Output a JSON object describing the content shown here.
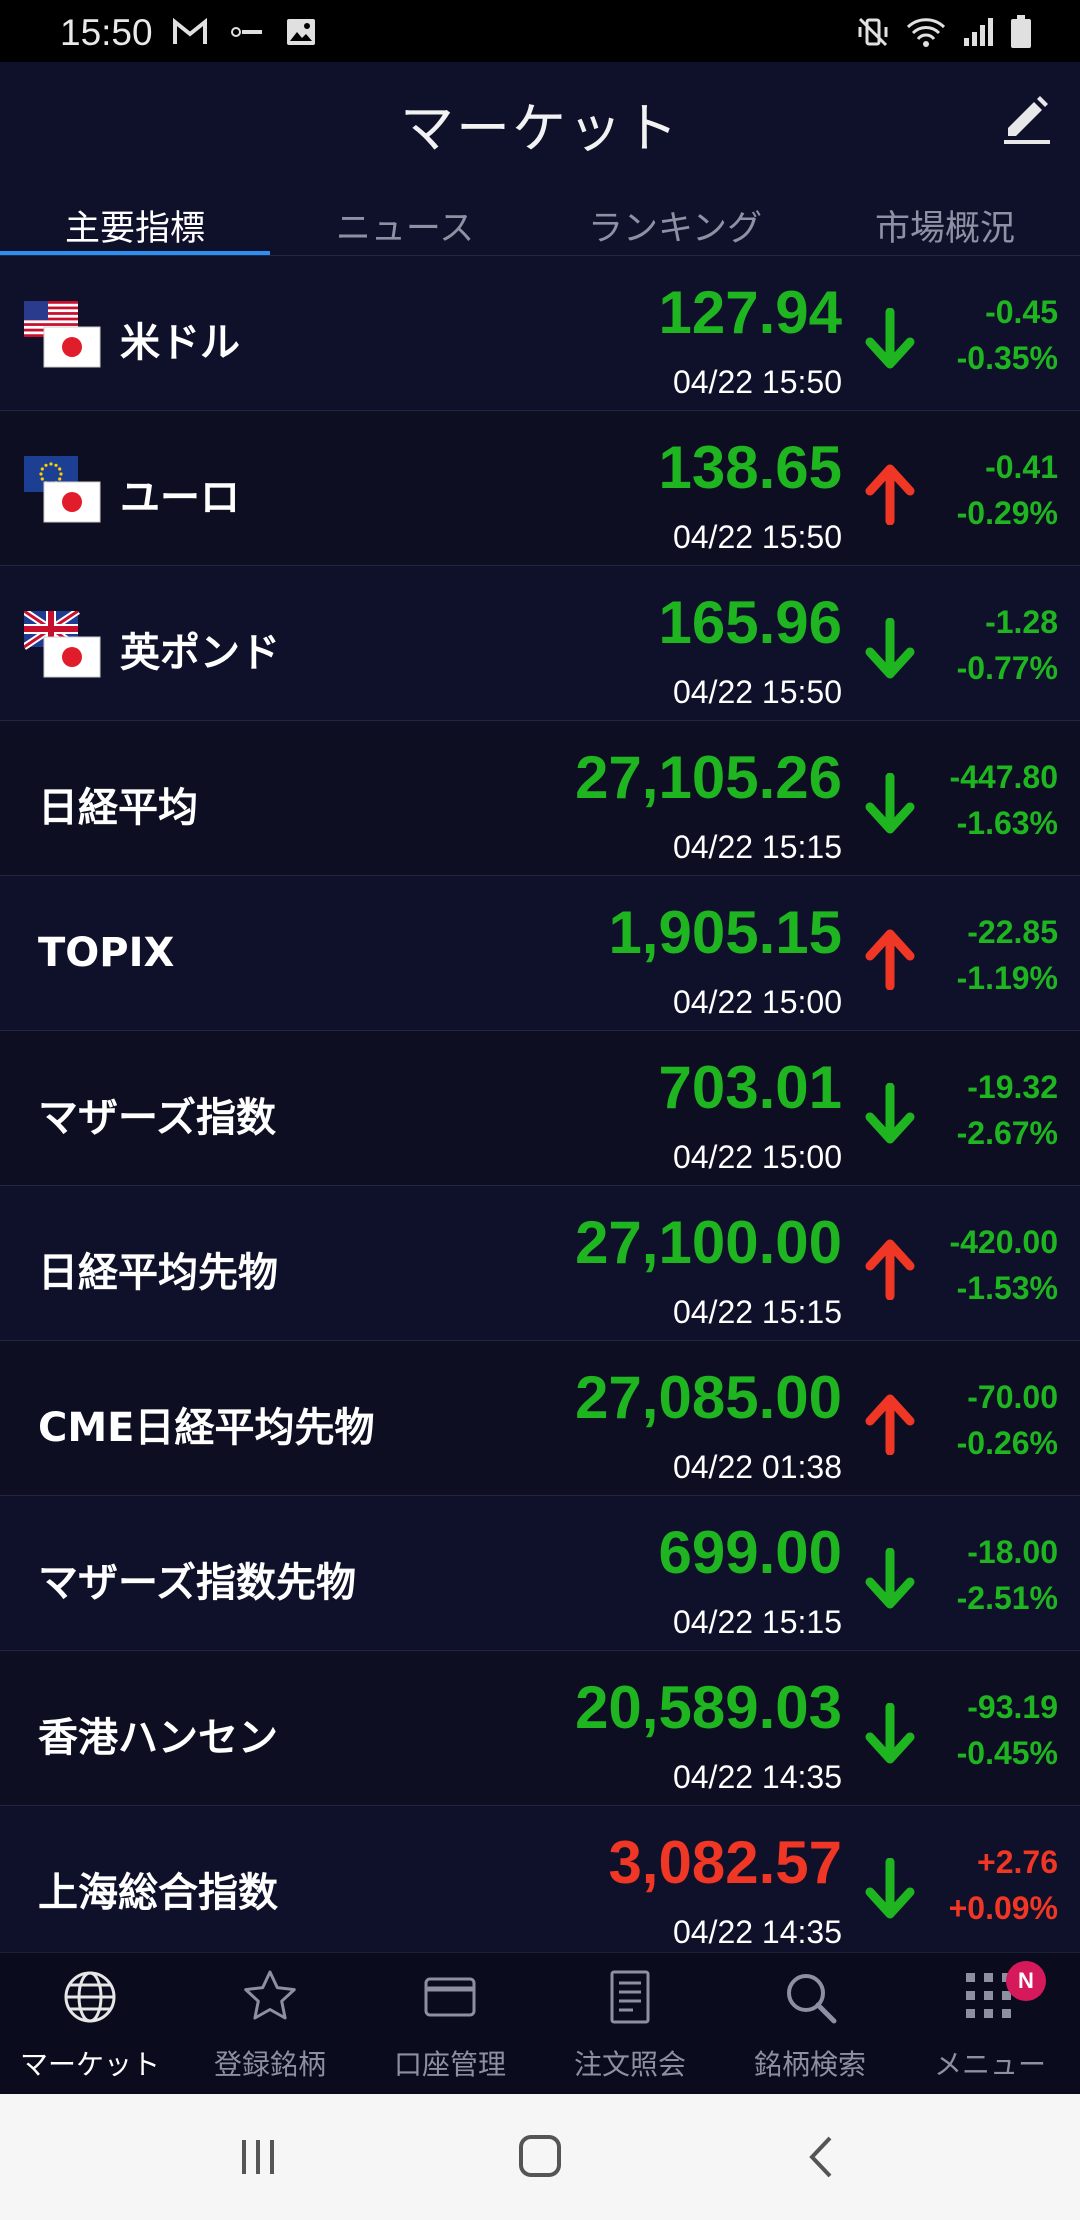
{
  "status_bar": {
    "time": "15:50"
  },
  "header": {
    "title": "マーケット"
  },
  "tabs": [
    {
      "label": "主要指標",
      "active": true
    },
    {
      "label": "ニュース",
      "active": false
    },
    {
      "label": "ランキング",
      "active": false
    },
    {
      "label": "市場概況",
      "active": false
    }
  ],
  "market_rows": [
    {
      "name": "米ドル",
      "flag": "us-jp",
      "price": "127.94",
      "time": "04/22 15:50",
      "arrow": "down",
      "change": "-0.45",
      "pct": "-0.35%",
      "price_color": "up",
      "change_color": "up"
    },
    {
      "name": "ユーロ",
      "flag": "eu-jp",
      "price": "138.65",
      "time": "04/22 15:50",
      "arrow": "up",
      "change": "-0.41",
      "pct": "-0.29%",
      "price_color": "up",
      "change_color": "up"
    },
    {
      "name": "英ポンド",
      "flag": "uk-jp",
      "price": "165.96",
      "time": "04/22 15:50",
      "arrow": "down",
      "change": "-1.28",
      "pct": "-0.77%",
      "price_color": "up",
      "change_color": "up"
    },
    {
      "name": "日経平均",
      "flag": "",
      "price": "27,105.26",
      "time": "04/22 15:15",
      "arrow": "down",
      "change": "-447.80",
      "pct": "-1.63%",
      "price_color": "up",
      "change_color": "up"
    },
    {
      "name": "TOPIX",
      "flag": "",
      "price": "1,905.15",
      "time": "04/22 15:00",
      "arrow": "up",
      "change": "-22.85",
      "pct": "-1.19%",
      "price_color": "up",
      "change_color": "up"
    },
    {
      "name": "マザーズ指数",
      "flag": "",
      "price": "703.01",
      "time": "04/22 15:00",
      "arrow": "down",
      "change": "-19.32",
      "pct": "-2.67%",
      "price_color": "up",
      "change_color": "up"
    },
    {
      "name": "日経平均先物",
      "flag": "",
      "price": "27,100.00",
      "time": "04/22 15:15",
      "arrow": "up",
      "change": "-420.00",
      "pct": "-1.53%",
      "price_color": "up",
      "change_color": "up"
    },
    {
      "name": "CME日経平均先物",
      "flag": "",
      "price": "27,085.00",
      "time": "04/22 01:38",
      "arrow": "up",
      "change": "-70.00",
      "pct": "-0.26%",
      "price_color": "up",
      "change_color": "up"
    },
    {
      "name": "マザーズ指数先物",
      "flag": "",
      "price": "699.00",
      "time": "04/22 15:15",
      "arrow": "down",
      "change": "-18.00",
      "pct": "-2.51%",
      "price_color": "up",
      "change_color": "up"
    },
    {
      "name": "香港ハンセン",
      "flag": "",
      "price": "20,589.03",
      "time": "04/22 14:35",
      "arrow": "down",
      "change": "-93.19",
      "pct": "-0.45%",
      "price_color": "up",
      "change_color": "up"
    },
    {
      "name": "上海総合指数",
      "flag": "",
      "price": "3,082.57",
      "time": "04/22 14:35",
      "arrow": "down",
      "change": "+2.76",
      "pct": "+0.09%",
      "price_color": "down",
      "change_color": "down"
    }
  ],
  "bottom_nav": [
    {
      "label": "マーケット",
      "icon": "globe-icon",
      "active": true
    },
    {
      "label": "登録銘柄",
      "icon": "star-icon",
      "active": false
    },
    {
      "label": "口座管理",
      "icon": "card-icon",
      "active": false
    },
    {
      "label": "注文照会",
      "icon": "document-icon",
      "active": false
    },
    {
      "label": "銘柄検索",
      "icon": "search-icon",
      "active": false
    },
    {
      "label": "メニュー",
      "icon": "grid-icon",
      "active": false,
      "badge": "N"
    }
  ],
  "colors": {
    "up_green": "#1fb521",
    "down_red": "#f03624",
    "accent_blue": "#2d8ff0",
    "badge": "#d6195a"
  }
}
